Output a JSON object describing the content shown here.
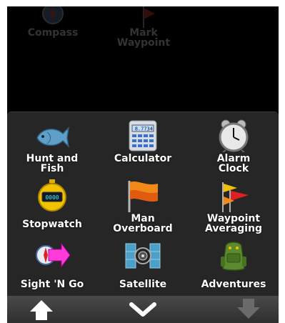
{
  "background_apps": [
    {
      "label": "Compass",
      "icon": "compass-icon"
    },
    {
      "label": "Mark\nWaypoint",
      "icon": "flag-icon"
    }
  ],
  "apps": [
    {
      "label": "Hunt and\nFish",
      "icon": "fish-icon"
    },
    {
      "label": "Calculator",
      "icon": "calculator-icon",
      "display": "8.7734"
    },
    {
      "label": "Alarm\nClock",
      "icon": "alarm-clock-icon"
    },
    {
      "label": "Stopwatch",
      "icon": "stopwatch-icon",
      "display": "0000"
    },
    {
      "label": "Man\nOverboard",
      "icon": "orange-flag-icon"
    },
    {
      "label": "Waypoint\nAveraging",
      "icon": "waypoint-flags-icon"
    },
    {
      "label": "Sight 'N Go",
      "icon": "compass-arrow-icon"
    },
    {
      "label": "Satellite",
      "icon": "satellite-icon"
    },
    {
      "label": "Adventures",
      "icon": "backpack-icon"
    }
  ],
  "bottom_bar": {
    "up": {
      "icon": "arrow-up-icon",
      "enabled": true
    },
    "collapse": {
      "icon": "chevron-down-icon",
      "enabled": true
    },
    "down": {
      "icon": "arrow-down-icon",
      "enabled": false
    }
  },
  "colors": {
    "drawer": "#262626",
    "label": "#ffffff",
    "disabled": "#6a6a6a"
  }
}
